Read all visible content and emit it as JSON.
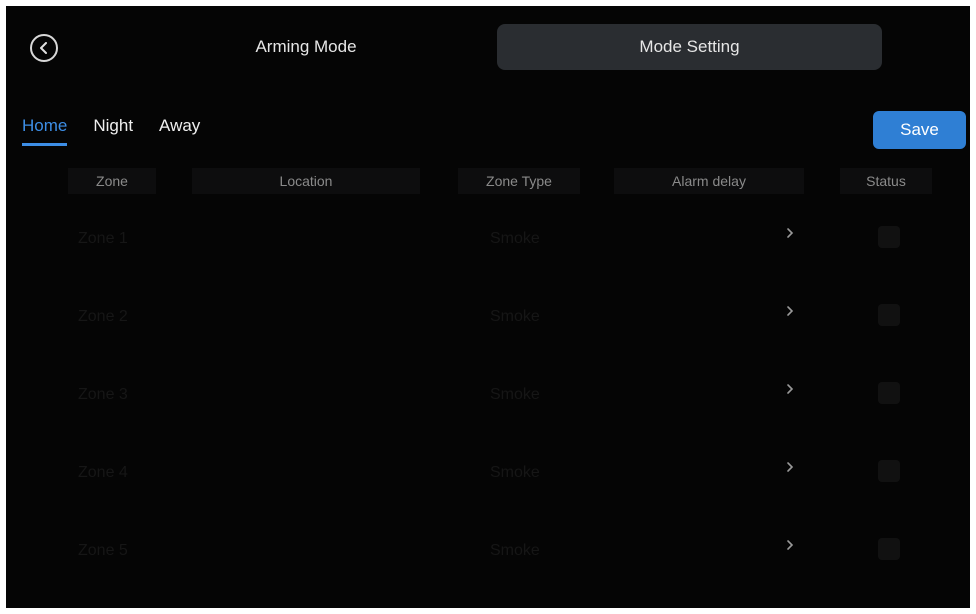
{
  "header": {
    "tab_arming": "Arming Mode",
    "tab_mode_setting": "Mode Setting"
  },
  "mode_tabs": [
    {
      "label": "Home",
      "active": true
    },
    {
      "label": "Night",
      "active": false
    },
    {
      "label": "Away",
      "active": false
    }
  ],
  "save_label": "Save",
  "columns": {
    "zone": "Zone",
    "location": "Location",
    "zone_type": "Zone Type",
    "alarm_delay": "Alarm delay",
    "status": "Status"
  },
  "rows": [
    {
      "zone": "Zone 1",
      "type": "Smoke"
    },
    {
      "zone": "Zone 2",
      "type": "Smoke"
    },
    {
      "zone": "Zone 3",
      "type": "Smoke"
    },
    {
      "zone": "Zone 4",
      "type": "Smoke"
    },
    {
      "zone": "Zone 5",
      "type": "Smoke"
    }
  ],
  "colors": {
    "accent": "#3d8ee6",
    "save_button": "#2f7fd4",
    "selected_top_tab": "#2a2d31"
  },
  "icons": {
    "back": "back-arrow-icon",
    "row_chevron": "chevron-right-icon"
  }
}
